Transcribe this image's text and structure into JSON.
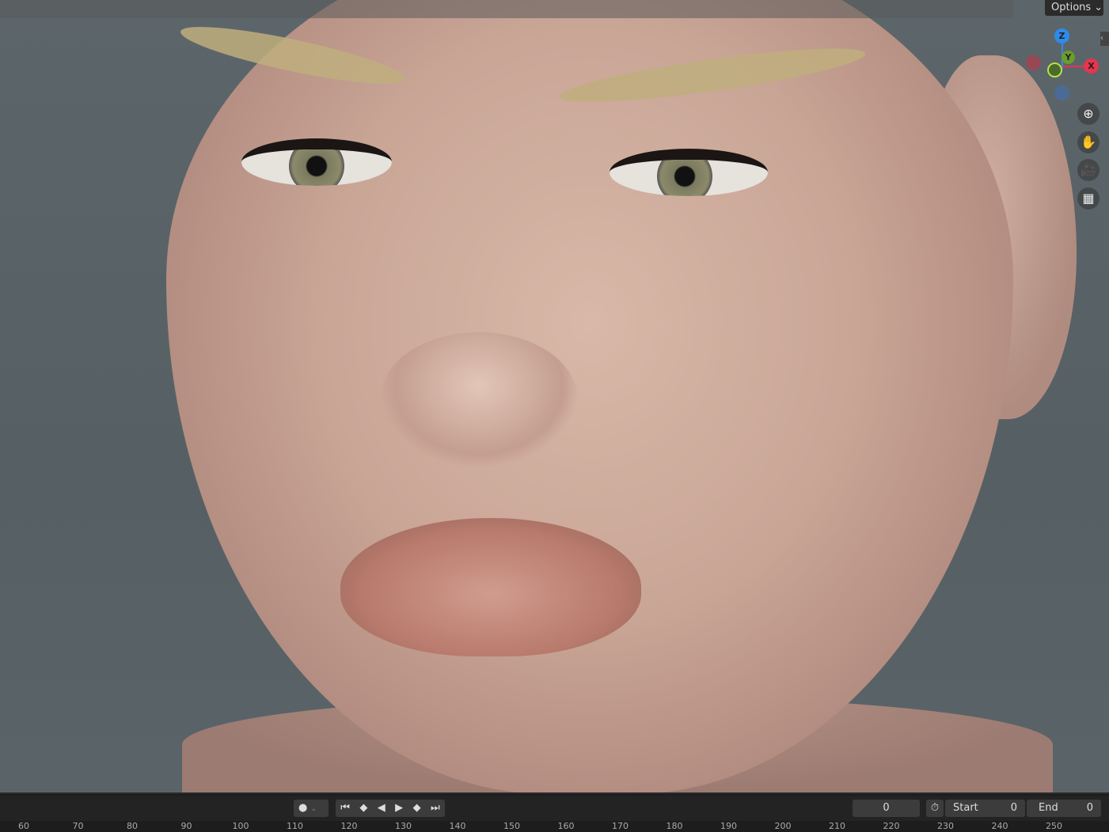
{
  "header": {
    "options_label": "Options"
  },
  "gizmo": {
    "axes": [
      "Z",
      "Y",
      "X"
    ],
    "colors": {
      "x": "#e8344e",
      "y": "#6a9e2a",
      "z": "#2d8ceb"
    }
  },
  "nav": {
    "icons": [
      "zoom-icon",
      "hand-pan-icon",
      "camera-icon",
      "grid-perspective-icon"
    ]
  },
  "timeline": {
    "current_frame": "0",
    "start_label": "Start",
    "start_value": "0",
    "end_label": "End",
    "end_value": "0"
  },
  "ruler": {
    "ticks": [
      "60",
      "70",
      "80",
      "90",
      "100",
      "110",
      "120",
      "130",
      "140",
      "150",
      "160",
      "170",
      "180",
      "190",
      "200",
      "210",
      "220",
      "230",
      "240",
      "250"
    ]
  }
}
